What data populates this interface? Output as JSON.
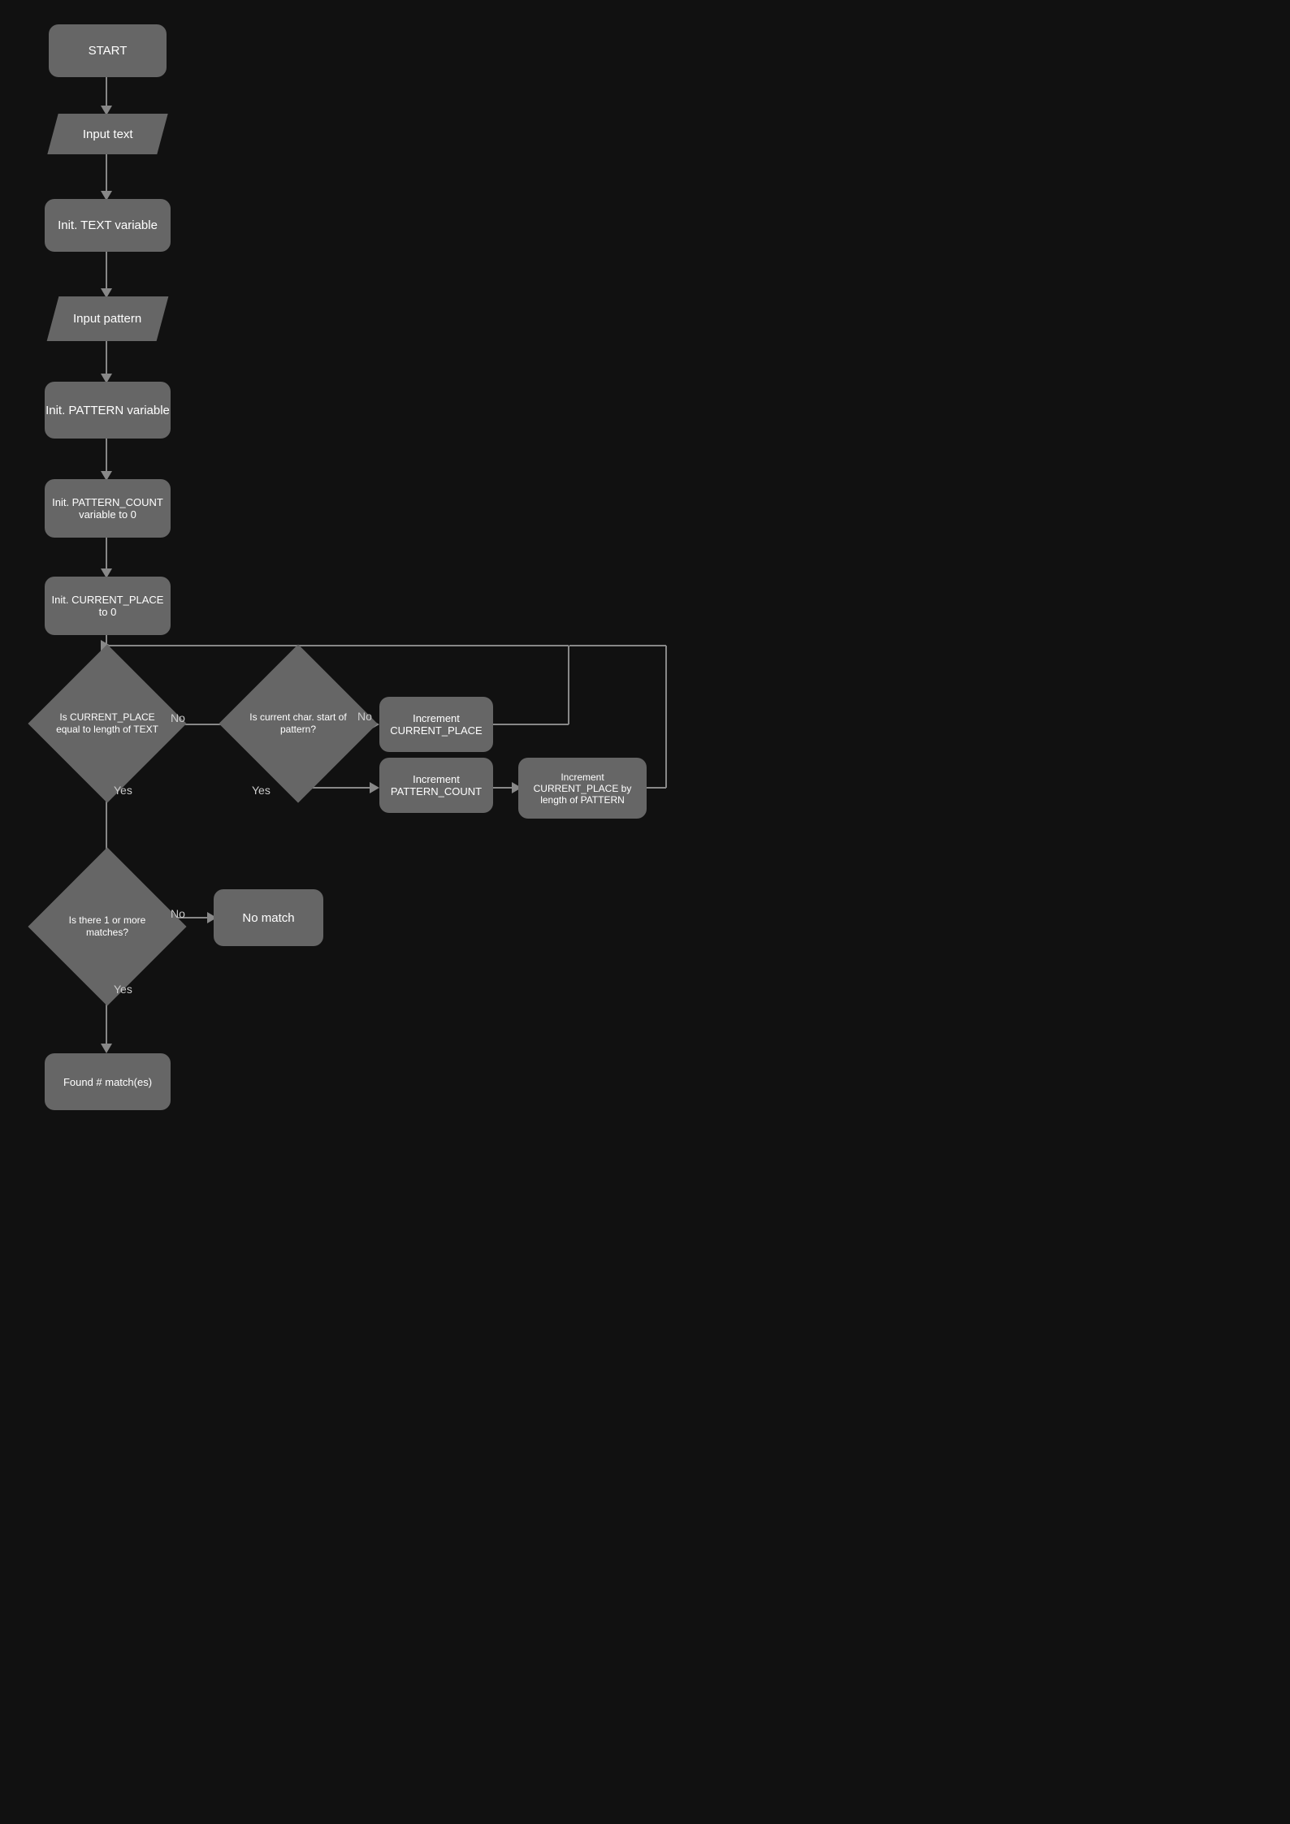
{
  "shapes": {
    "start": "START",
    "input_text": "Input text",
    "init_text": "Init. TEXT variable",
    "input_pattern": "Input pattern",
    "init_pattern": "Init. PATTERN variable",
    "init_pattern_count": "Init. PATTERN_COUNT variable to 0",
    "init_current_place": "Init. CURRENT_PLACE to 0",
    "diamond_current_place": "Is CURRENT_PLACE equal to length of TEXT",
    "diamond_char_start": "Is current char. start of pattern?",
    "increment_current_place": "Increment CURRENT_PLACE",
    "increment_pattern_count": "Increment PATTERN_COUNT",
    "increment_current_place_by": "Increment CURRENT_PLACE by length of PATTERN",
    "diamond_matches": "Is there 1 or more matches?",
    "no_match": "No match",
    "found_match": "Found # match(es)",
    "label_no_1": "No",
    "label_yes_1": "Yes",
    "label_no_2": "No",
    "label_yes_2": "Yes",
    "label_no_3": "No",
    "label_yes_3": "Yes"
  }
}
